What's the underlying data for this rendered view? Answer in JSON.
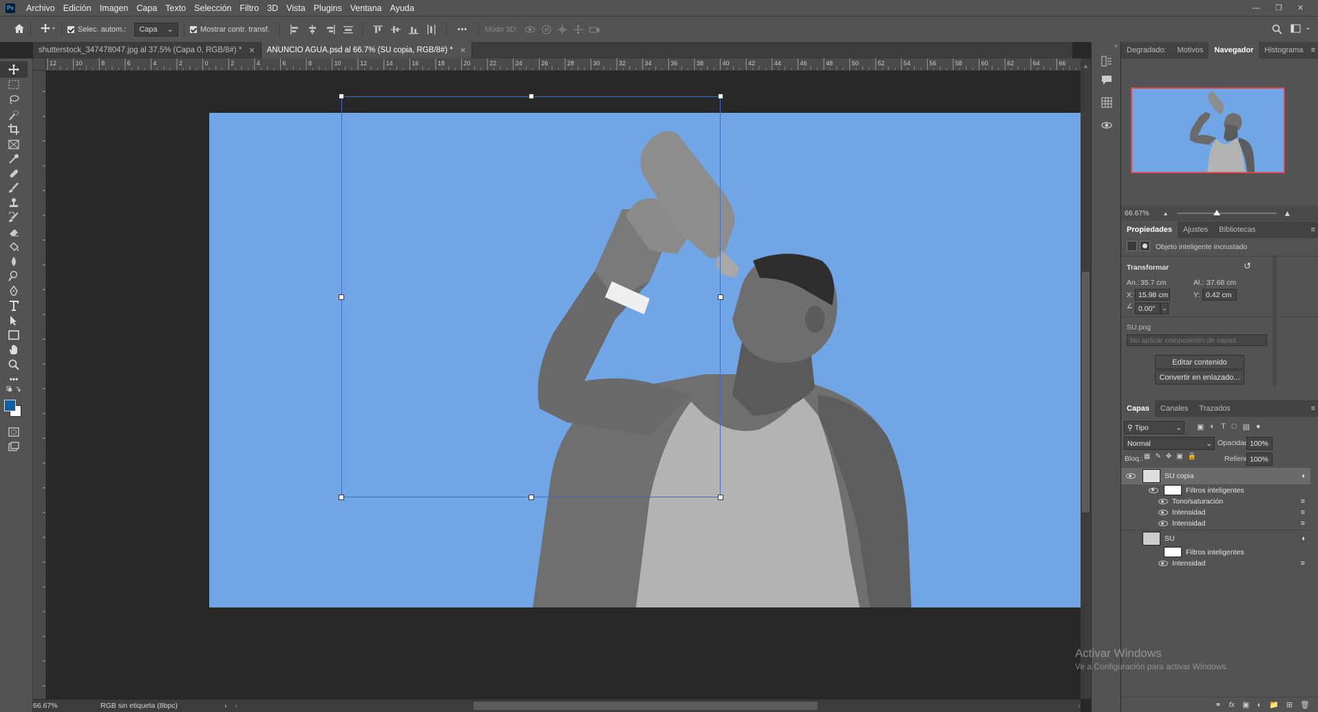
{
  "app": {
    "logo": "Ps"
  },
  "menu": [
    "Archivo",
    "Edición",
    "Imagen",
    "Capa",
    "Texto",
    "Selección",
    "Filtro",
    "3D",
    "Vista",
    "Plugins",
    "Ventana",
    "Ayuda"
  ],
  "options": {
    "auto_select_label": "Selec. autom.:",
    "auto_select_value": "Capa",
    "show_transform_label": "Mostrar contr. transf.",
    "mode3d_label": "Modo 3D:"
  },
  "tabs": [
    {
      "label": "shutterstock_347478047.jpg al 37.5% (Capa 0, RGB/8#) *",
      "active": false
    },
    {
      "label": "ANUNCIO AGUA.psd al 66.7% (SU copia, RGB/8#) *",
      "active": true
    }
  ],
  "ruler": {
    "top_ticks": [
      "12",
      "10",
      "8",
      "6",
      "4",
      "2",
      "0",
      "2",
      "4",
      "6",
      "8",
      "10",
      "12",
      "14",
      "16",
      "18",
      "20",
      "22",
      "24",
      "26",
      "28",
      "30",
      "32",
      "34",
      "36",
      "38",
      "40",
      "42",
      "44",
      "46",
      "48",
      "50",
      "52",
      "54",
      "56",
      "58",
      "60",
      "62",
      "64",
      "66"
    ]
  },
  "status": {
    "zoom": "66.67%",
    "color_profile": "RGB sin etiqueta (8bpc)"
  },
  "nav_panel": {
    "tabs": [
      "Degradado:",
      "Motivos",
      "Navegador",
      "Histograma"
    ],
    "active_tab": "Navegador",
    "zoom": "66.67%",
    "zoom_fraction": 0.4
  },
  "properties": {
    "tabs": [
      "Propiedades",
      "Ajustes",
      "Bibliotecas"
    ],
    "active_tab": "Propiedades",
    "object_type": "Objeto inteligente incrustado",
    "transform_title": "Transformar",
    "w_label": "An.:",
    "w_value": "35.7 cm",
    "h_label": "Al.:",
    "h_value": "37.68 cm",
    "x_label": "X:",
    "x_value": "15.98 cm",
    "y_label": "Y:",
    "y_value": "0.42 cm",
    "angle_value": "0.00°",
    "file": "SU.png",
    "comp_placeholder": "No aplicar composición de capas",
    "edit_button": "Editar contenido",
    "convert_button": "Convertir en enlazado..."
  },
  "layers": {
    "tabs": [
      "Capas",
      "Canales",
      "Trazados"
    ],
    "active_tab": "Capas",
    "filter_label": "Tipo",
    "blend_mode": "Normal",
    "opacity_label": "Opacidad:",
    "opacity_value": "100%",
    "lock_label": "Bloq.:",
    "fill_label": "Relleno:",
    "fill_value": "100%",
    "rows": [
      {
        "name": "SU copia",
        "type": "layer"
      },
      {
        "name": "Filtros inteligentes",
        "type": "smartfilter"
      },
      {
        "name": "Tono/saturación",
        "type": "filter"
      },
      {
        "name": "Intensidad",
        "type": "filter"
      },
      {
        "name": "Intensidad",
        "type": "filter"
      },
      {
        "name": "SU",
        "type": "layer"
      },
      {
        "name": "Filtros inteligentes",
        "type": "smartfilter"
      },
      {
        "name": "Intensidad",
        "type": "filter"
      }
    ]
  },
  "watermark": {
    "line1": "Activar Windows",
    "line2": "Ve a Configuración para activar Windows."
  },
  "colors": {
    "fg": "#0b5fa5",
    "bg": "#ffffff",
    "doc_bg": "#70a5e6"
  }
}
